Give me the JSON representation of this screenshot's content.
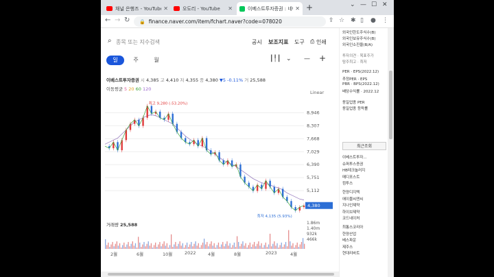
{
  "browser": {
    "tabs": [
      {
        "title": "채널 은행즈 - YouTube",
        "type": "yt"
      },
      {
        "title": "오도리 - YouTube",
        "type": "yt"
      },
      {
        "title": "이베스트투자증권 : 네이",
        "type": "nv"
      }
    ],
    "url": "finance.naver.com/item/fchart.naver?code=078020"
  },
  "search": {
    "placeholder": "종목 또는 지수검색",
    "links": [
      "공시",
      "보조지표",
      "도구",
      "인쇄"
    ]
  },
  "periods": [
    "일",
    "주",
    "월"
  ],
  "stock": {
    "name": "이베스트투자증권",
    "open_label": "시",
    "open": "4,385",
    "high_label": "고",
    "high": "4,410",
    "low_label": "저",
    "low": "4,355",
    "close_label": "종",
    "close": "4,380",
    "change": "▼5 -0.11%",
    "volume_label": "거",
    "volume": "25,588",
    "ma_label": "이동평균",
    "ma_values": [
      "5",
      "20",
      "60",
      "120"
    ],
    "scale_mode": "Linear"
  },
  "chart_data": {
    "type": "line",
    "title": "",
    "y_ticks": [
      8946,
      8307,
      7668,
      7029,
      6390,
      5751,
      5112
    ],
    "current_price": 4380,
    "max_label": "최고 9,280 (-53.20%)",
    "min_label": "최저 4,135 (5.93%)",
    "x_ticks": [
      "2월",
      "6월",
      "10월",
      "2022",
      "4월",
      "8월",
      "2023",
      "4월"
    ],
    "price_series": [
      7300,
      7200,
      7500,
      7100,
      7600,
      8100,
      8400,
      8600,
      8300,
      8700,
      9280,
      8900,
      9000,
      8700,
      8600,
      8900,
      8400,
      8000,
      7700,
      7500,
      7400,
      7600,
      7300,
      7700,
      7100,
      6900,
      7000,
      6600,
      6400,
      6600,
      6300,
      6400,
      5800,
      5500,
      5300,
      5100,
      5400,
      5200,
      5600,
      5300,
      5000,
      5200,
      4800,
      4600,
      4300,
      4135,
      4300,
      4380
    ],
    "ma_series": [
      7400,
      7500,
      7600,
      7700,
      7900,
      8100,
      8300,
      8500,
      8600,
      8700,
      8800,
      8850,
      8800,
      8700,
      8600,
      8500,
      8400,
      8200,
      8000,
      7800,
      7650,
      7500,
      7400,
      7300,
      7200,
      7050,
      6900,
      6750,
      6600,
      6500,
      6400,
      6300,
      6150,
      6000,
      5850,
      5700,
      5600,
      5500,
      5450,
      5400,
      5300,
      5250,
      5150,
      5000,
      4900,
      4800,
      4700,
      4650
    ],
    "volume_ticks": [
      "1.86m",
      "1.40m",
      "932k",
      "466k"
    ],
    "volume_label": "거래량",
    "volume_value": "25,588"
  },
  "sidebar": {
    "items": [
      {
        "text": "외국인한도주식수(B)",
        "gray": false
      },
      {
        "text": "외국인보유주식수(B)",
        "gray": false
      },
      {
        "text": "외국인소진율(B/A)",
        "gray": false
      },
      {
        "text": "투자의견 · 목표주가",
        "gray": true
      },
      {
        "text": "탐주최고 · 최저",
        "gray": true
      },
      {
        "text": "PER · EPS(2022.12)",
        "gray": false
      },
      {
        "text": "추정PER · EPS",
        "gray": false
      },
      {
        "text": "PBR · BPS(2022.12)",
        "gray": false
      },
      {
        "text": "배당수익률 · 2022.12",
        "gray": false
      },
      {
        "text": "동일업종 PER",
        "gray": false
      },
      {
        "text": "동일업종 등락률",
        "gray": false
      }
    ],
    "recent_label": "최근조회",
    "recent_items": [
      "이베스트투자...",
      "슈퍼투스증권",
      "HB테크놀러지",
      "메디포스트",
      "컴투스",
      "한양디지텍",
      "에이블씨엔씨",
      "지나인제약",
      "하이브제약",
      "코드네이처",
      "최통스코리아",
      "한양산업",
      "베스파운",
      "제주스",
      "현대리바트"
    ]
  }
}
